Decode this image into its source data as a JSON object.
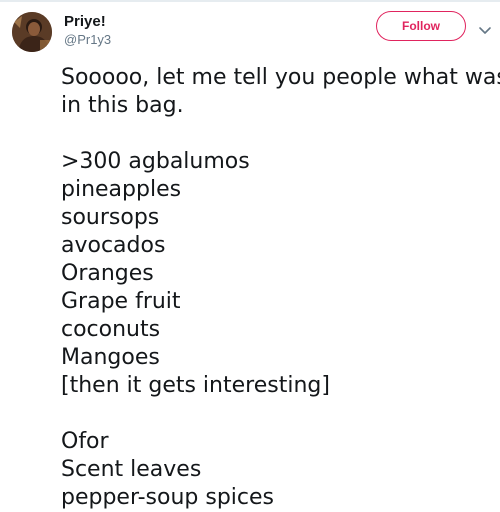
{
  "user": {
    "display_name": "Priye!",
    "handle": "@Pr1y3"
  },
  "header": {
    "follow_label": "Follow",
    "caret_icon": "chevron-down-icon"
  },
  "tweet": {
    "lines": [
      "Sooooo, let me tell you people what was",
      "in this bag.",
      "",
      ">300 agbalumos",
      "pineapples",
      "soursops",
      "avocados",
      "Oranges",
      "Grape fruit",
      "coconuts",
      "Mangoes",
      "[then it gets interesting]",
      "",
      "Ofor",
      "Scent leaves",
      "pepper-soup spices"
    ]
  },
  "colors": {
    "accent": "#e0245e",
    "text": "#14171a",
    "secondary": "#657786"
  }
}
